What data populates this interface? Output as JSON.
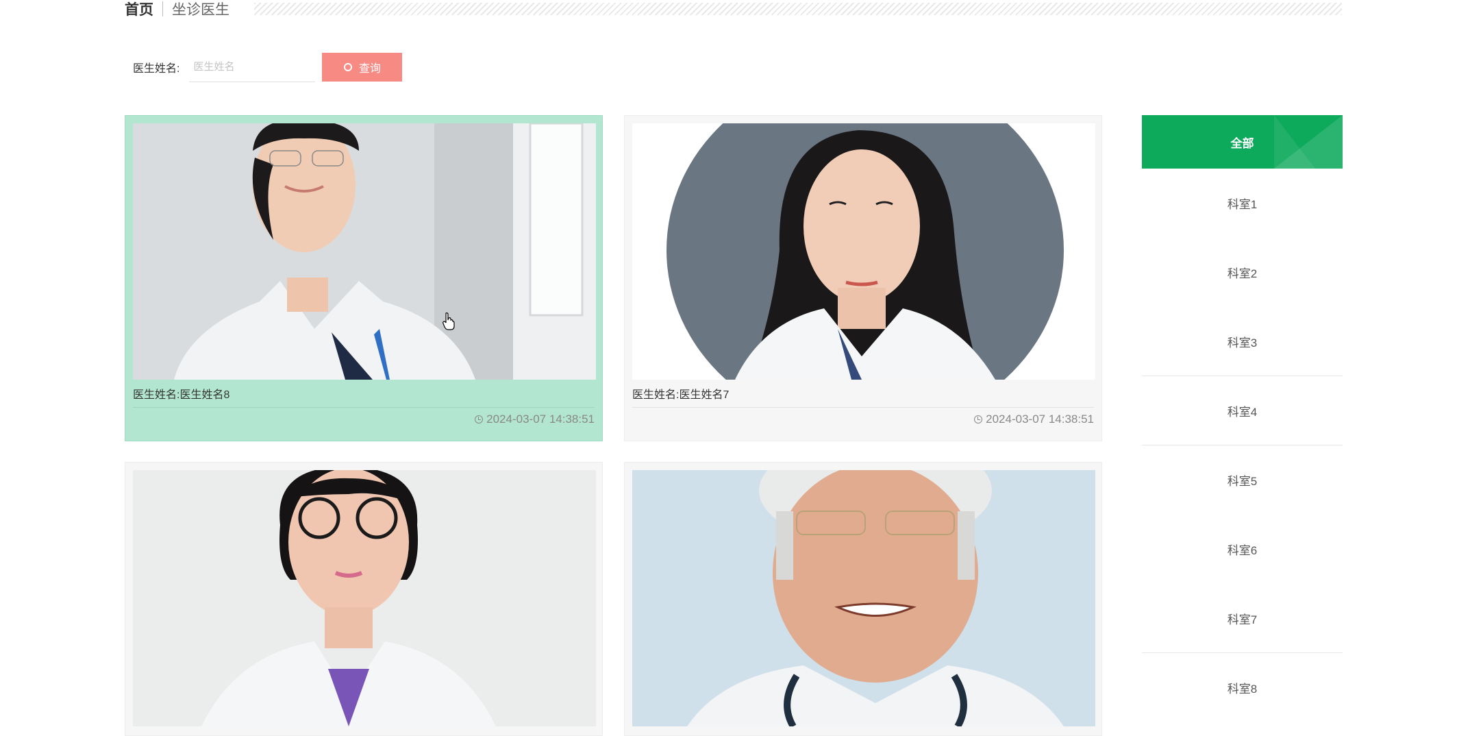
{
  "breadcrumb": {
    "home": "首页",
    "current": "坐诊医生"
  },
  "search": {
    "label": "医生姓名:",
    "placeholder": "医生姓名",
    "button": "查询"
  },
  "cards": [
    {
      "name": "医生姓名:医生姓名8",
      "time": "2024-03-07 14:38:51",
      "photo": "doctor-photo-woman-glasses-sitting"
    },
    {
      "name": "医生姓名:医生姓名7",
      "time": "2024-03-07 14:38:51",
      "photo": "doctor-photo-woman-circle-portrait"
    },
    {
      "photo": "doctor-photo-woman-round-glasses"
    },
    {
      "photo": "doctor-photo-elderly-man-stethoscope"
    }
  ],
  "sidebar": {
    "all": "全部",
    "items": [
      "科室1",
      "科室2",
      "科室3",
      "科室4",
      "科室5",
      "科室6",
      "科室7",
      "科室8"
    ]
  },
  "colors": {
    "accent": "#0eaa5c",
    "search_button": "#f88a84",
    "active_card": "#b2e6d0"
  }
}
